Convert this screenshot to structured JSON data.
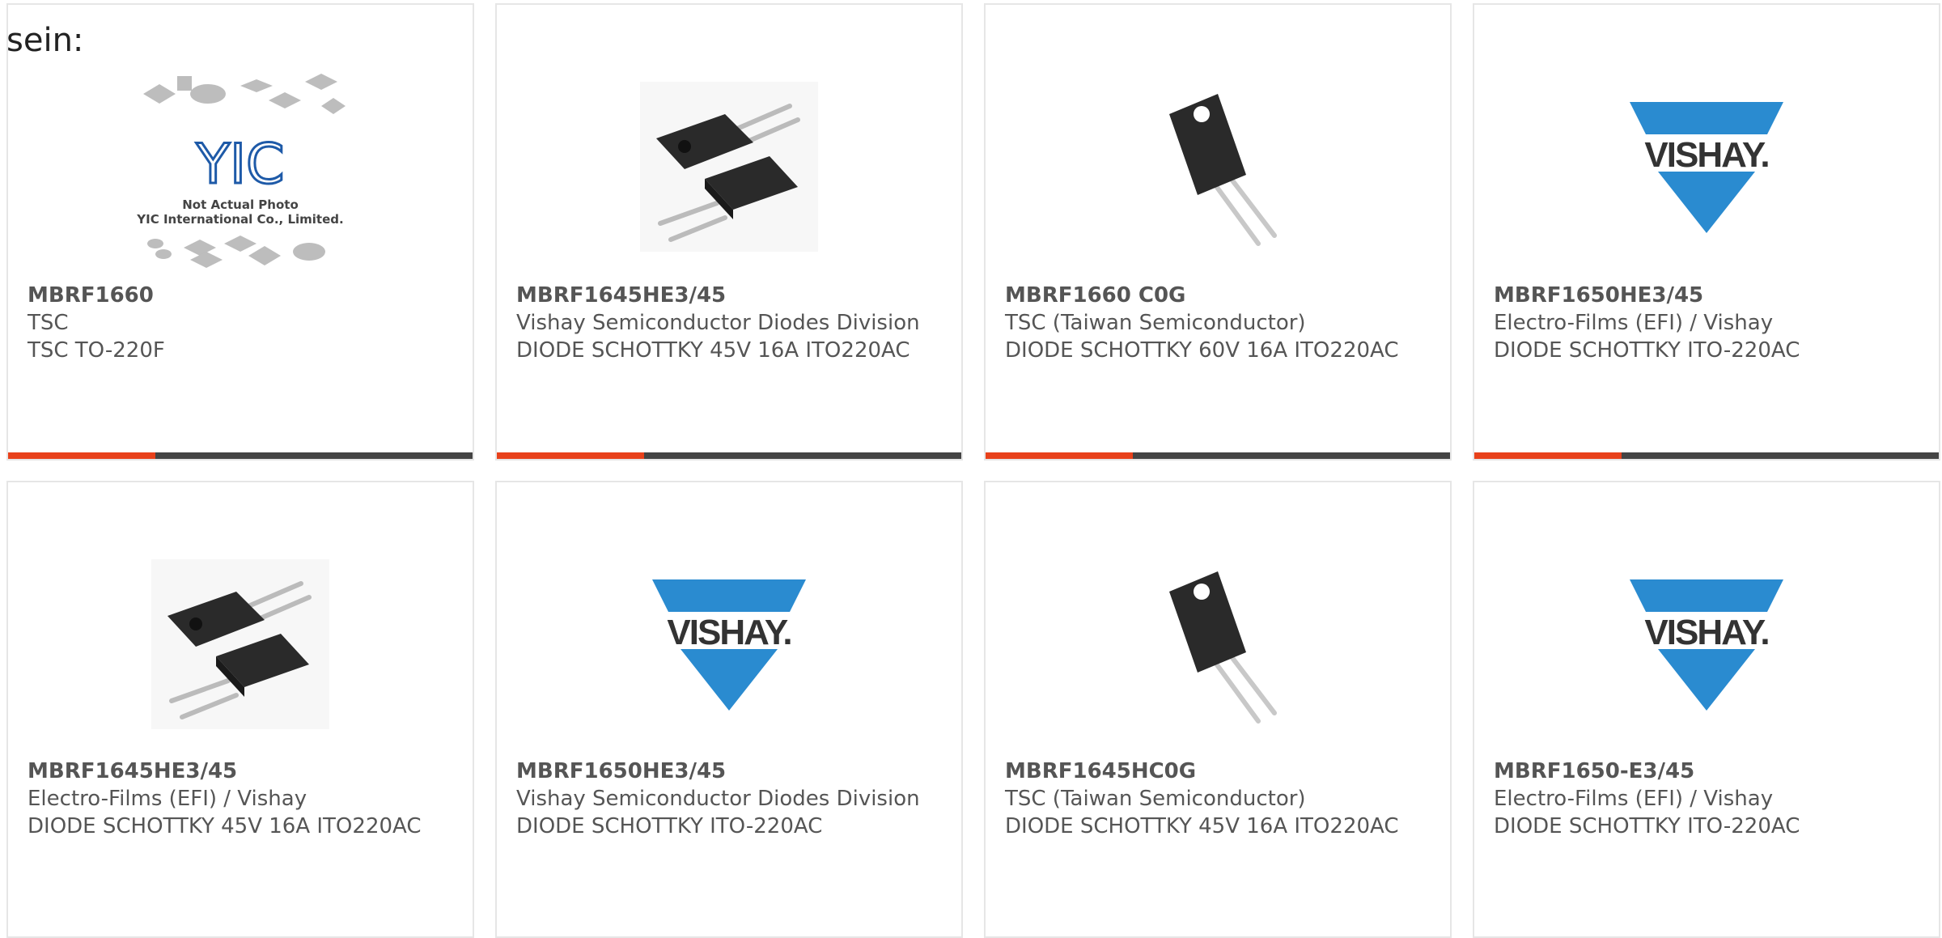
{
  "lead_text": "sein:",
  "accent_color": "#e8411b",
  "bar_color": "#444444",
  "products": [
    {
      "part": "MBRF1660",
      "manufacturer": "TSC",
      "description": "TSC TO-220F",
      "image": "yic-placeholder",
      "placeholder_line1": "Not Actual Photo",
      "placeholder_line2": "YIC International Co., Limited.",
      "logo_text": "YIC"
    },
    {
      "part": "MBRF1645HE3/45",
      "manufacturer": "Vishay Semiconductor Diodes Division",
      "description": "DIODE SCHOTTKY 45V 16A ITO220AC",
      "image": "to220-pair"
    },
    {
      "part": "MBRF1660 C0G",
      "manufacturer": "TSC (Taiwan Semiconductor)",
      "description": "DIODE SCHOTTKY 60V 16A ITO220AC",
      "image": "to220-single"
    },
    {
      "part": "MBRF1650HE3/45",
      "manufacturer": "Electro-Films (EFI) / Vishay",
      "description": "DIODE SCHOTTKY ITO-220AC",
      "image": "vishay-logo",
      "logo_text": "VISHAY."
    },
    {
      "part": "MBRF1645HE3/45",
      "manufacturer": "Electro-Films (EFI) / Vishay",
      "description": "DIODE SCHOTTKY 45V 16A ITO220AC",
      "image": "to220-pair"
    },
    {
      "part": "MBRF1650HE3/45",
      "manufacturer": "Vishay Semiconductor Diodes Division",
      "description": "DIODE SCHOTTKY ITO-220AC",
      "image": "vishay-logo",
      "logo_text": "VISHAY."
    },
    {
      "part": "MBRF1645HC0G",
      "manufacturer": "TSC (Taiwan Semiconductor)",
      "description": "DIODE SCHOTTKY 45V 16A ITO220AC",
      "image": "to220-single"
    },
    {
      "part": "MBRF1650-E3/45",
      "manufacturer": "Electro-Films (EFI) / Vishay",
      "description": "DIODE SCHOTTKY ITO-220AC",
      "image": "vishay-logo",
      "logo_text": "VISHAY."
    }
  ]
}
